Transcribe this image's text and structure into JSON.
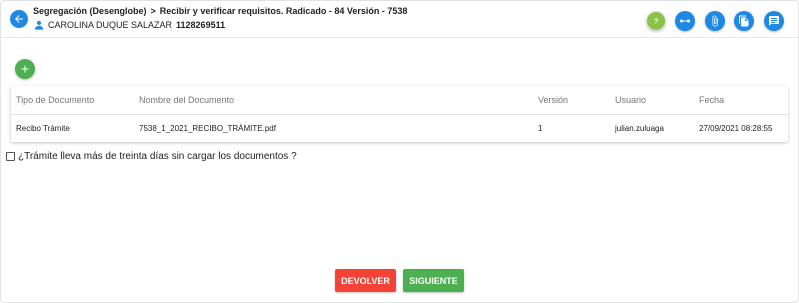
{
  "header": {
    "breadcrumb": {
      "section": "Segregación (Desenglobe)",
      "separator": ">",
      "current": "Recibir y verificar requisitos. Radicado - 84 Versión - 7538"
    },
    "user": {
      "name": "CAROLINA DUQUE SALAZAR",
      "id": "1128269511"
    },
    "icons": {
      "back": "arrow-left-icon",
      "help": "question-icon",
      "flow": "flow-icon",
      "attach": "paperclip-icon",
      "documents": "documents-icon",
      "notes": "notes-icon"
    },
    "help_label": "?"
  },
  "table": {
    "columns": [
      "Tipo de Documento",
      "Nombre del Documento",
      "Versión",
      "Usuario",
      "Fecha"
    ],
    "rows": [
      {
        "tipo": "Recibo Trámite",
        "nombre": "7538_1_2021_RECIBO_TRÁMITE.pdf",
        "version": "1",
        "usuario": "julian.zuluaga",
        "fecha": "27/09/2021 08:28:55"
      }
    ]
  },
  "checkbox": {
    "label": "¿Trámite lleva más de treinta días sin cargar los documentos ?",
    "checked": false
  },
  "actions": {
    "devolver": "DEVOLVER",
    "siguiente": "SIGUIENTE"
  },
  "colors": {
    "primary": "#1e88e5",
    "success": "#4caf50",
    "danger": "#f44336",
    "help": "#8bc34a"
  }
}
